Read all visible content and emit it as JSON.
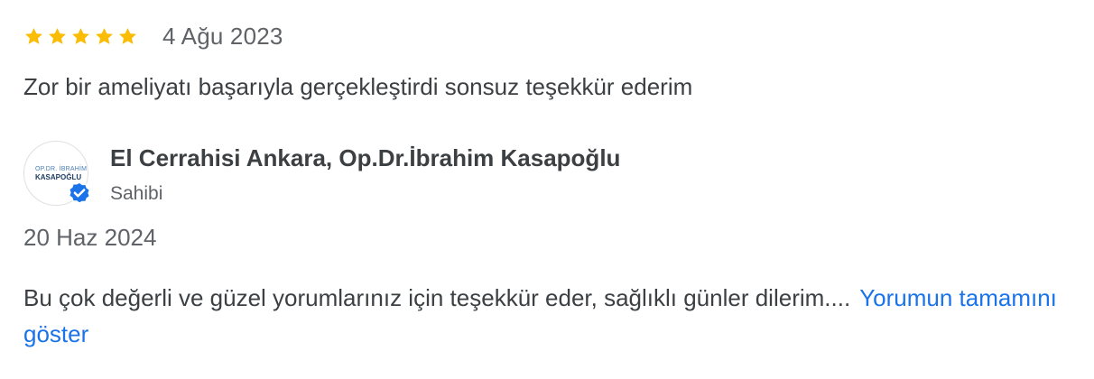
{
  "review": {
    "rating": 5,
    "max_rating": 5,
    "star_color": "#fbbc04",
    "date": "4 Ağu 2023",
    "text": "Zor bir ameliyatı başarıyla gerçekleştirdi sonsuz teşekkür ederim"
  },
  "owner_reply": {
    "name": "El Cerrahisi Ankara, Op.Dr.İbrahim Kasapoğlu",
    "role": "Sahibi",
    "avatar_text_line1": "OP.DR. İBRAHİM",
    "avatar_text_line2": "KASAPOĞLU",
    "verified_icon": "verified-check-icon",
    "verified_color": "#1a73e8",
    "date": "20 Haz 2024",
    "text": "Bu çok değerli ve güzel yorumlarınız için teşekkür eder, sağlıklı günler dilerim....",
    "more_link": "Yorumun tamamını göster",
    "link_color": "#1a73e8"
  }
}
